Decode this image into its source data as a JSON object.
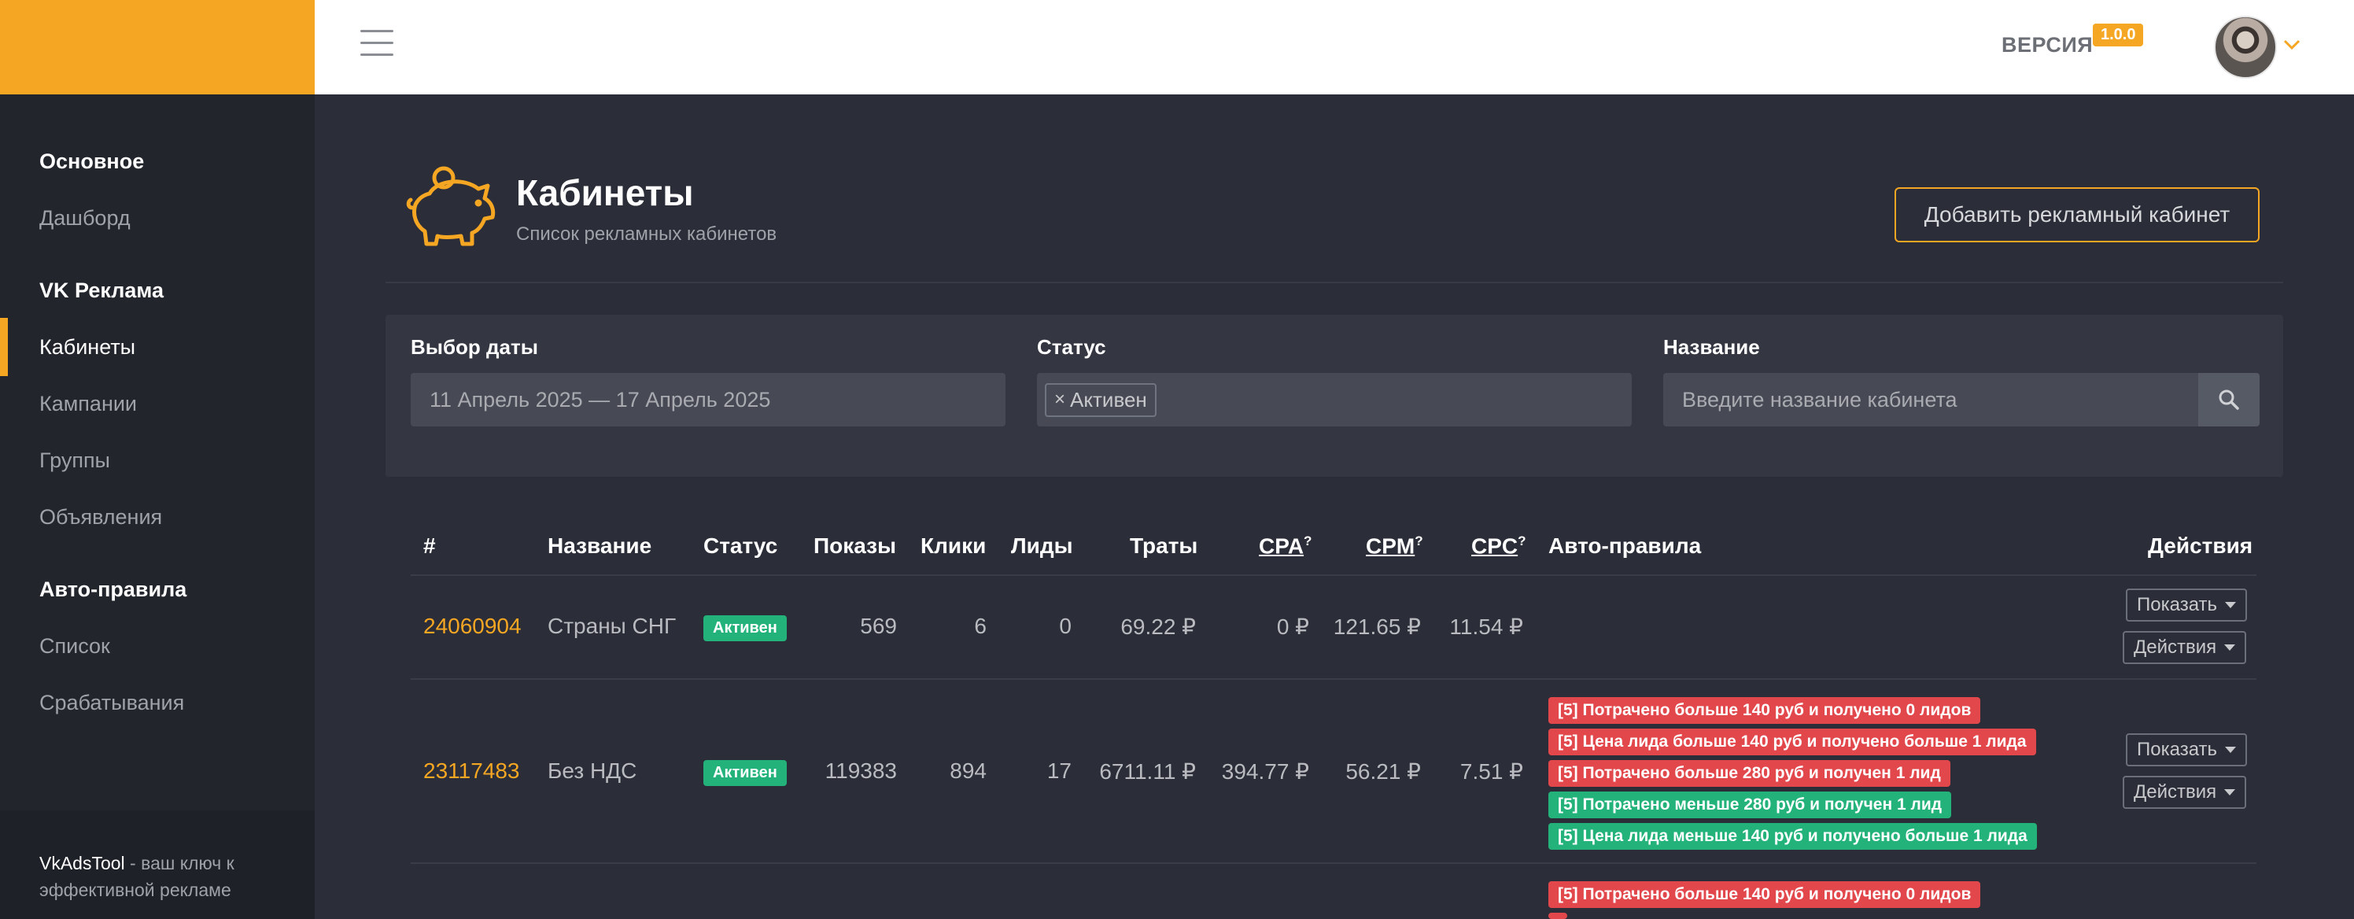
{
  "header": {
    "version_label": "ВЕРСИЯ",
    "version_value": "1.0.0"
  },
  "sidebar": {
    "sections": [
      {
        "heading": "Основное",
        "items": [
          "Дашборд"
        ]
      },
      {
        "heading": "VK Реклама",
        "items": [
          "Кабинеты",
          "Кампании",
          "Группы",
          "Объявления"
        ]
      },
      {
        "heading": "Авто-правила",
        "items": [
          "Список",
          "Срабатывания"
        ]
      }
    ],
    "active_item": "Кабинеты",
    "footer_brand": "VkAdsTool",
    "footer_text": " - ваш ключ к эффективной рекламе"
  },
  "page": {
    "title": "Кабинеты",
    "subtitle": "Список рекламных кабинетов",
    "add_button": "Добавить рекламный кабинет"
  },
  "filters": {
    "date_label": "Выбор даты",
    "date_value": "11 Апрель 2025 — 17 Апрель 2025",
    "status_label": "Статус",
    "status_chip": "Активен",
    "name_label": "Название",
    "name_placeholder": "Введите название кабинета"
  },
  "table": {
    "columns": {
      "id": "#",
      "name": "Название",
      "status": "Статус",
      "impressions": "Показы",
      "clicks": "Клики",
      "leads": "Лиды",
      "spend": "Траты",
      "cpa": "CPA",
      "cpm": "CPM",
      "cpc": "CPC",
      "hint": "?",
      "rules": "Авто-правила",
      "actions": "Действия"
    },
    "show_button": "Показать",
    "actions_button": "Действия",
    "rows": [
      {
        "id": "24060904",
        "name": "Страны СНГ",
        "status": "Активен",
        "impressions": "569",
        "clicks": "6",
        "leads": "0",
        "spend": "69.22 ₽",
        "cpa": "0 ₽",
        "cpm": "121.65 ₽",
        "cpc": "11.54 ₽",
        "rules": []
      },
      {
        "id": "23117483",
        "name": "Без НДС",
        "status": "Активен",
        "impressions": "119383",
        "clicks": "894",
        "leads": "17",
        "spend": "6711.11 ₽",
        "cpa": "394.77 ₽",
        "cpm": "56.21 ₽",
        "cpc": "7.51 ₽",
        "rules": [
          {
            "text": "[5] Потрачено больше 140 руб и получено 0 лидов",
            "color": "red"
          },
          {
            "text": "[5] Цена лида больше 140 руб и получено больше 1 лида",
            "color": "red"
          },
          {
            "text": "[5] Потрачено больше 280 руб и получен 1 лид",
            "color": "red"
          },
          {
            "text": "[5] Потрачено меньше 280 руб и получен 1 лид",
            "color": "green"
          },
          {
            "text": "[5] Цена лида меньше 140 руб и получено больше 1 лида",
            "color": "green"
          }
        ]
      },
      {
        "partial": true,
        "rules": [
          {
            "text": "[5] Потрачено больше 140 руб и получено 0 лидов",
            "color": "red"
          }
        ]
      }
    ]
  },
  "colors": {
    "accent": "#f5a623",
    "active_badge": "#23b37a",
    "rule_red": "#e2474b",
    "rule_green": "#23b37a"
  }
}
